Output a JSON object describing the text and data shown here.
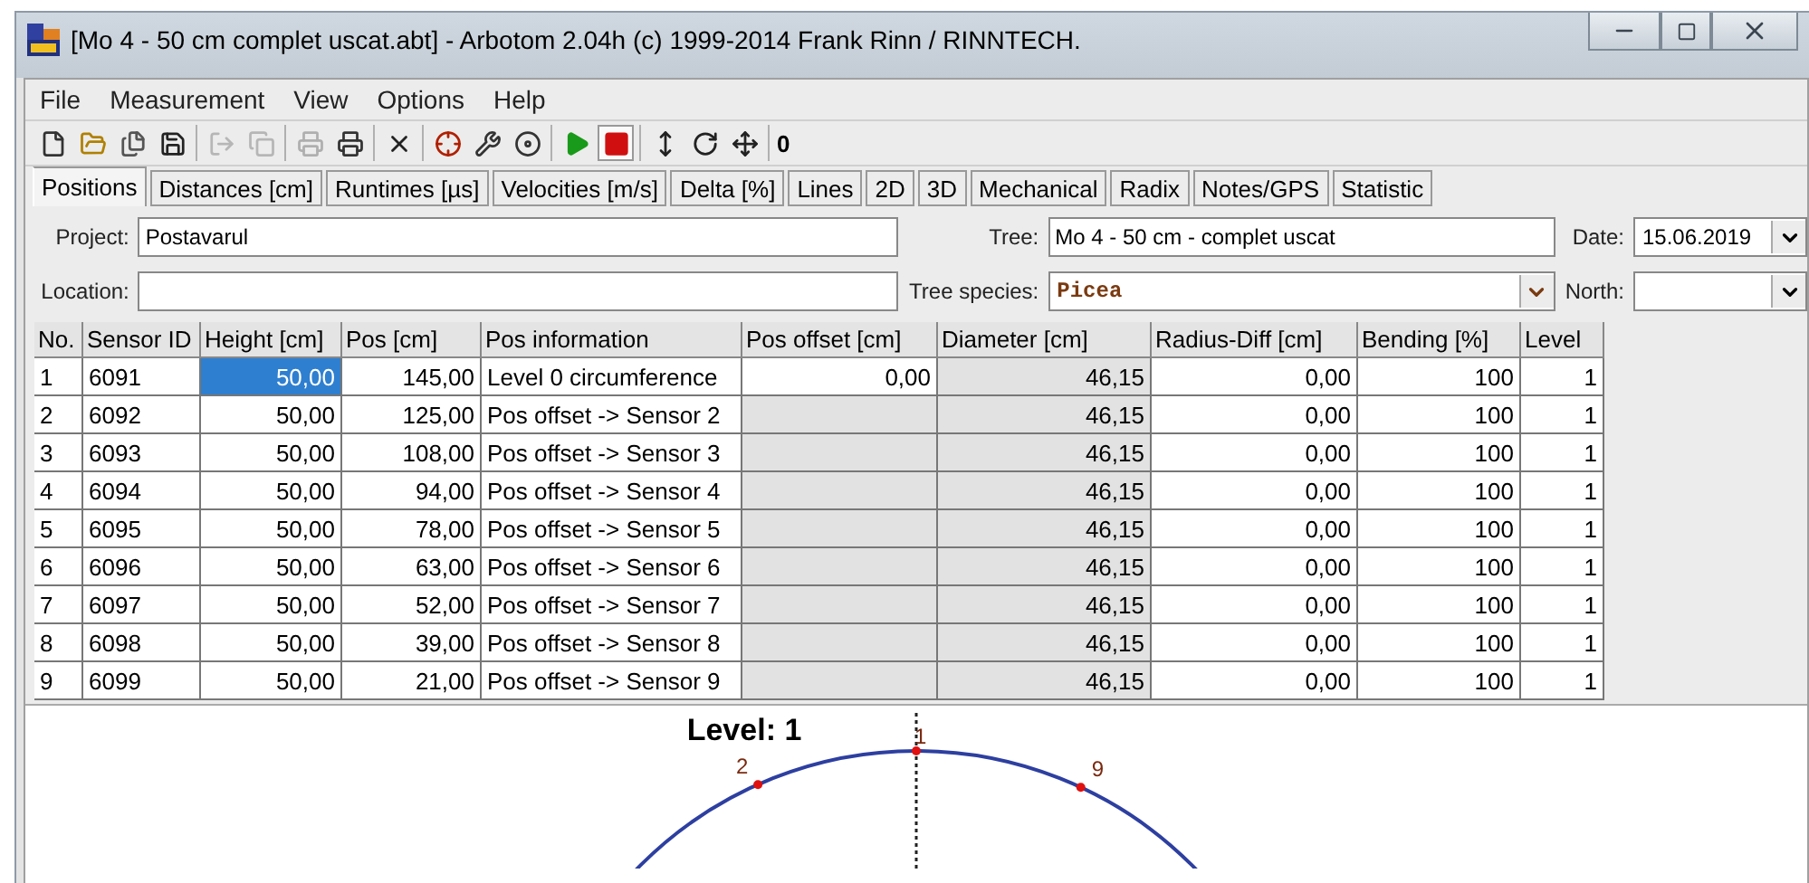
{
  "window": {
    "title": "[Mo 4 - 50 cm complet uscat.abt] - Arbotom 2.04h (c) 1999-2014 Frank Rinn / RINNTECH."
  },
  "menu": [
    "File",
    "Measurement",
    "View",
    "Options",
    "Help"
  ],
  "toolbar": {
    "groups": [
      [
        {
          "disabled": false,
          "pressed": false
        },
        {
          "disabled": false,
          "pressed": false
        },
        {
          "disabled": false,
          "pressed": false
        },
        {
          "disabled": false,
          "pressed": false
        }
      ],
      [
        {
          "disabled": true,
          "pressed": false
        },
        {
          "disabled": true,
          "pressed": false
        }
      ],
      [
        {
          "disabled": true,
          "pressed": false
        },
        {
          "disabled": false,
          "pressed": false
        }
      ],
      [
        {
          "disabled": false,
          "pressed": false
        }
      ],
      [
        {
          "disabled": false,
          "pressed": false
        },
        {
          "disabled": false,
          "pressed": false
        },
        {
          "disabled": false,
          "pressed": false
        }
      ],
      [
        {
          "disabled": false,
          "pressed": false
        },
        {
          "disabled": false,
          "pressed": true
        }
      ],
      [
        {
          "disabled": false,
          "pressed": false
        },
        {
          "disabled": false,
          "pressed": false
        },
        {
          "disabled": false,
          "pressed": false
        }
      ]
    ],
    "counter": "0"
  },
  "tabs": [
    {
      "label": "Positions",
      "selected": true
    },
    {
      "label": "Distances [cm]",
      "selected": false
    },
    {
      "label": "Runtimes [µs]",
      "selected": false
    },
    {
      "label": "Velocities [m/s]",
      "selected": false
    },
    {
      "label": "Delta [%]",
      "selected": false
    },
    {
      "label": "Lines",
      "selected": false
    },
    {
      "label": "2D",
      "selected": false
    },
    {
      "label": "3D",
      "selected": false
    },
    {
      "label": "Mechanical",
      "selected": false
    },
    {
      "label": "Radix",
      "selected": false
    },
    {
      "label": "Notes/GPS",
      "selected": false
    },
    {
      "label": "Statistic",
      "selected": false
    }
  ],
  "form": {
    "project": {
      "label": "Project:",
      "value": "Postavarul"
    },
    "location": {
      "label": "Location:"
    },
    "tree": {
      "label": "Tree:",
      "value": "Mo 4 - 50 cm - complet uscat"
    },
    "tree_species": {
      "label": "Tree species:",
      "value": "Picea"
    },
    "date": {
      "label": "Date:",
      "value": "15.06.2019"
    },
    "north": {
      "label": "North:"
    }
  },
  "table": {
    "columns": [
      {
        "label": "No.",
        "kind": "text"
      },
      {
        "label": "Sensor ID",
        "kind": "text"
      },
      {
        "label": "Height [cm]",
        "kind": "number"
      },
      {
        "label": "Pos [cm]",
        "kind": "number"
      },
      {
        "label": "Pos information",
        "kind": "text"
      },
      {
        "label": "Pos offset [cm]",
        "kind": "offset"
      },
      {
        "label": "Diameter [cm]",
        "kind": "readonly"
      },
      {
        "label": "Radius-Diff [cm]",
        "kind": "number"
      },
      {
        "label": "Bending [%]",
        "kind": "number"
      },
      {
        "label": "Level",
        "kind": "number"
      }
    ],
    "rows": [
      {
        "cells": [
          "1",
          "6091",
          "50,00",
          "145,00",
          "Level 0 circumference",
          "0,00",
          "46,15",
          "0,00",
          "100",
          "1"
        ],
        "offset_editable": true,
        "height_selected": true
      },
      {
        "cells": [
          "2",
          "6092",
          "50,00",
          "125,00",
          "Pos offset -> Sensor 2",
          "",
          "46,15",
          "0,00",
          "100",
          "1"
        ],
        "offset_editable": false,
        "height_selected": false
      },
      {
        "cells": [
          "3",
          "6093",
          "50,00",
          "108,00",
          "Pos offset -> Sensor 3",
          "",
          "46,15",
          "0,00",
          "100",
          "1"
        ],
        "offset_editable": false,
        "height_selected": false
      },
      {
        "cells": [
          "4",
          "6094",
          "50,00",
          "94,00",
          "Pos offset -> Sensor 4",
          "",
          "46,15",
          "0,00",
          "100",
          "1"
        ],
        "offset_editable": false,
        "height_selected": false
      },
      {
        "cells": [
          "5",
          "6095",
          "50,00",
          "78,00",
          "Pos offset -> Sensor 5",
          "",
          "46,15",
          "0,00",
          "100",
          "1"
        ],
        "offset_editable": false,
        "height_selected": false
      },
      {
        "cells": [
          "6",
          "6096",
          "50,00",
          "63,00",
          "Pos offset -> Sensor 6",
          "",
          "46,15",
          "0,00",
          "100",
          "1"
        ],
        "offset_editable": false,
        "height_selected": false
      },
      {
        "cells": [
          "7",
          "6097",
          "50,00",
          "52,00",
          "Pos offset -> Sensor 7",
          "",
          "46,15",
          "0,00",
          "100",
          "1"
        ],
        "offset_editable": false,
        "height_selected": false
      },
      {
        "cells": [
          "8",
          "6098",
          "50,00",
          "39,00",
          "Pos offset -> Sensor 8",
          "",
          "46,15",
          "0,00",
          "100",
          "1"
        ],
        "offset_editable": false,
        "height_selected": false
      },
      {
        "cells": [
          "9",
          "6099",
          "50,00",
          "21,00",
          "Pos offset -> Sensor 9",
          "",
          "46,15",
          "0,00",
          "100",
          "1"
        ],
        "offset_editable": false,
        "height_selected": false
      }
    ]
  },
  "diagram": {
    "title": "Level: 1",
    "sensors": [
      "1",
      "2",
      "9"
    ]
  }
}
